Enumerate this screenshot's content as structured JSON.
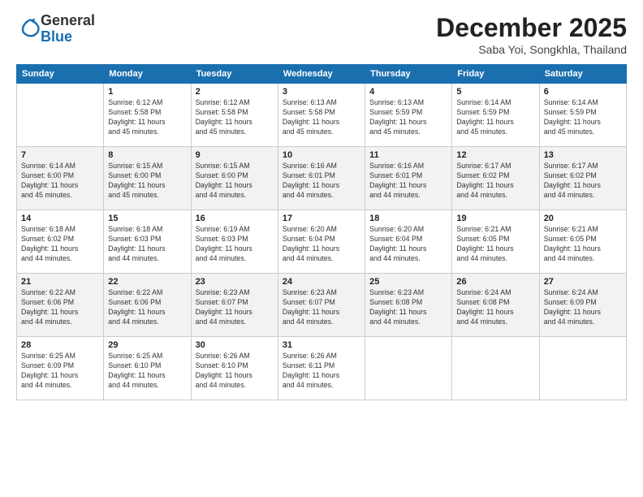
{
  "header": {
    "logo": {
      "general": "General",
      "blue": "Blue"
    },
    "title": "December 2025",
    "subtitle": "Saba Yoi, Songkhla, Thailand"
  },
  "days_of_week": [
    "Sunday",
    "Monday",
    "Tuesday",
    "Wednesday",
    "Thursday",
    "Friday",
    "Saturday"
  ],
  "weeks": [
    [
      {
        "day": "",
        "info": ""
      },
      {
        "day": "1",
        "info": "Sunrise: 6:12 AM\nSunset: 5:58 PM\nDaylight: 11 hours\nand 45 minutes."
      },
      {
        "day": "2",
        "info": "Sunrise: 6:12 AM\nSunset: 5:58 PM\nDaylight: 11 hours\nand 45 minutes."
      },
      {
        "day": "3",
        "info": "Sunrise: 6:13 AM\nSunset: 5:58 PM\nDaylight: 11 hours\nand 45 minutes."
      },
      {
        "day": "4",
        "info": "Sunrise: 6:13 AM\nSunset: 5:59 PM\nDaylight: 11 hours\nand 45 minutes."
      },
      {
        "day": "5",
        "info": "Sunrise: 6:14 AM\nSunset: 5:59 PM\nDaylight: 11 hours\nand 45 minutes."
      },
      {
        "day": "6",
        "info": "Sunrise: 6:14 AM\nSunset: 5:59 PM\nDaylight: 11 hours\nand 45 minutes."
      }
    ],
    [
      {
        "day": "7",
        "info": "Sunrise: 6:14 AM\nSunset: 6:00 PM\nDaylight: 11 hours\nand 45 minutes."
      },
      {
        "day": "8",
        "info": "Sunrise: 6:15 AM\nSunset: 6:00 PM\nDaylight: 11 hours\nand 45 minutes."
      },
      {
        "day": "9",
        "info": "Sunrise: 6:15 AM\nSunset: 6:00 PM\nDaylight: 11 hours\nand 44 minutes."
      },
      {
        "day": "10",
        "info": "Sunrise: 6:16 AM\nSunset: 6:01 PM\nDaylight: 11 hours\nand 44 minutes."
      },
      {
        "day": "11",
        "info": "Sunrise: 6:16 AM\nSunset: 6:01 PM\nDaylight: 11 hours\nand 44 minutes."
      },
      {
        "day": "12",
        "info": "Sunrise: 6:17 AM\nSunset: 6:02 PM\nDaylight: 11 hours\nand 44 minutes."
      },
      {
        "day": "13",
        "info": "Sunrise: 6:17 AM\nSunset: 6:02 PM\nDaylight: 11 hours\nand 44 minutes."
      }
    ],
    [
      {
        "day": "14",
        "info": "Sunrise: 6:18 AM\nSunset: 6:02 PM\nDaylight: 11 hours\nand 44 minutes."
      },
      {
        "day": "15",
        "info": "Sunrise: 6:18 AM\nSunset: 6:03 PM\nDaylight: 11 hours\nand 44 minutes."
      },
      {
        "day": "16",
        "info": "Sunrise: 6:19 AM\nSunset: 6:03 PM\nDaylight: 11 hours\nand 44 minutes."
      },
      {
        "day": "17",
        "info": "Sunrise: 6:20 AM\nSunset: 6:04 PM\nDaylight: 11 hours\nand 44 minutes."
      },
      {
        "day": "18",
        "info": "Sunrise: 6:20 AM\nSunset: 6:04 PM\nDaylight: 11 hours\nand 44 minutes."
      },
      {
        "day": "19",
        "info": "Sunrise: 6:21 AM\nSunset: 6:05 PM\nDaylight: 11 hours\nand 44 minutes."
      },
      {
        "day": "20",
        "info": "Sunrise: 6:21 AM\nSunset: 6:05 PM\nDaylight: 11 hours\nand 44 minutes."
      }
    ],
    [
      {
        "day": "21",
        "info": "Sunrise: 6:22 AM\nSunset: 6:06 PM\nDaylight: 11 hours\nand 44 minutes."
      },
      {
        "day": "22",
        "info": "Sunrise: 6:22 AM\nSunset: 6:06 PM\nDaylight: 11 hours\nand 44 minutes."
      },
      {
        "day": "23",
        "info": "Sunrise: 6:23 AM\nSunset: 6:07 PM\nDaylight: 11 hours\nand 44 minutes."
      },
      {
        "day": "24",
        "info": "Sunrise: 6:23 AM\nSunset: 6:07 PM\nDaylight: 11 hours\nand 44 minutes."
      },
      {
        "day": "25",
        "info": "Sunrise: 6:23 AM\nSunset: 6:08 PM\nDaylight: 11 hours\nand 44 minutes."
      },
      {
        "day": "26",
        "info": "Sunrise: 6:24 AM\nSunset: 6:08 PM\nDaylight: 11 hours\nand 44 minutes."
      },
      {
        "day": "27",
        "info": "Sunrise: 6:24 AM\nSunset: 6:09 PM\nDaylight: 11 hours\nand 44 minutes."
      }
    ],
    [
      {
        "day": "28",
        "info": "Sunrise: 6:25 AM\nSunset: 6:09 PM\nDaylight: 11 hours\nand 44 minutes."
      },
      {
        "day": "29",
        "info": "Sunrise: 6:25 AM\nSunset: 6:10 PM\nDaylight: 11 hours\nand 44 minutes."
      },
      {
        "day": "30",
        "info": "Sunrise: 6:26 AM\nSunset: 6:10 PM\nDaylight: 11 hours\nand 44 minutes."
      },
      {
        "day": "31",
        "info": "Sunrise: 6:26 AM\nSunset: 6:11 PM\nDaylight: 11 hours\nand 44 minutes."
      },
      {
        "day": "",
        "info": ""
      },
      {
        "day": "",
        "info": ""
      },
      {
        "day": "",
        "info": ""
      }
    ]
  ]
}
